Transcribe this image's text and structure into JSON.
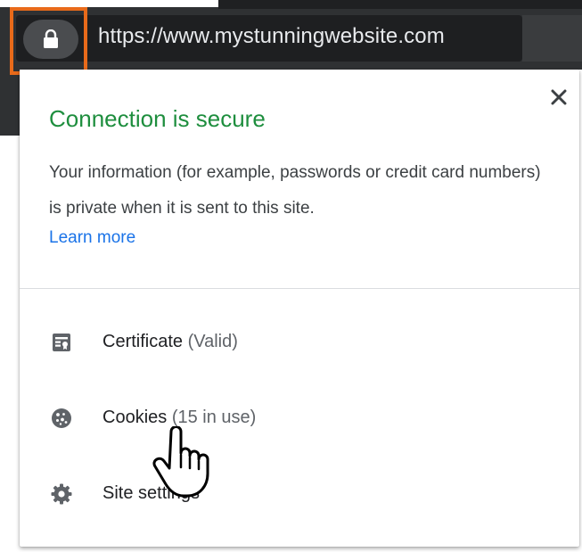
{
  "omnibox": {
    "url": "https://www.mystunningwebsite.com",
    "lock_icon": "lock-icon"
  },
  "popup": {
    "title": "Connection is secure",
    "description": "Your information (for example, passwords or credit card numbers) is private when it is sent to this site.",
    "learn_more": "Learn more",
    "close_icon": "close-icon",
    "items": [
      {
        "label": "Certificate",
        "status": "(Valid)",
        "icon": "certificate-icon"
      },
      {
        "label": "Cookies",
        "status": "(15 in use)",
        "icon": "cookie-icon"
      },
      {
        "label": "Site settings",
        "status": "",
        "icon": "gear-icon"
      }
    ]
  },
  "colors": {
    "secure_green": "#1e8e3e",
    "link_blue": "#1a73e8",
    "highlight_orange": "#e86a1a",
    "chrome_dark": "#2f3133"
  }
}
